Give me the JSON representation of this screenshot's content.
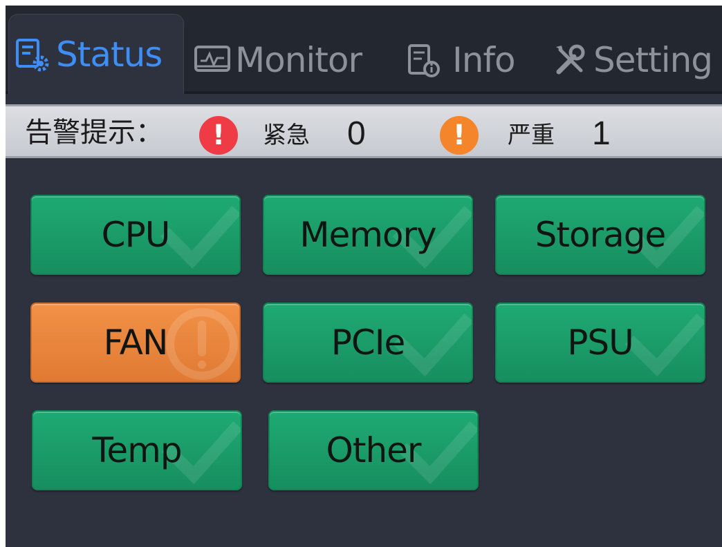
{
  "tabs": [
    {
      "label": "Status",
      "icon": "status-gear-icon",
      "active": true
    },
    {
      "label": "Monitor",
      "icon": "monitor-icon",
      "active": false
    },
    {
      "label": "Info",
      "icon": "info-document-icon",
      "active": false
    },
    {
      "label": "Setting",
      "icon": "tools-icon",
      "active": false
    }
  ],
  "alert_bar": {
    "title": "告警提示：",
    "critical": {
      "label": "紧急",
      "count": "0",
      "color": "#ee3b45",
      "icon": "critical-alert-icon"
    },
    "major": {
      "label": "严重",
      "count": "1",
      "color": "#f5852b",
      "icon": "major-alert-icon"
    }
  },
  "tiles": [
    {
      "label": "CPU",
      "status": "ok"
    },
    {
      "label": "Memory",
      "status": "ok"
    },
    {
      "label": "Storage",
      "status": "ok"
    },
    {
      "label": "FAN",
      "status": "warning"
    },
    {
      "label": "PCIe",
      "status": "ok"
    },
    {
      "label": "PSU",
      "status": "ok"
    },
    {
      "label": "Temp",
      "status": "ok"
    },
    {
      "label": "Other",
      "status": "ok"
    }
  ],
  "colors": {
    "background": "#2d323e",
    "tab_active": "#3e8ef7",
    "tab_inactive": "#8d9199",
    "ok": "#1faa73",
    "warning": "#f29147"
  }
}
